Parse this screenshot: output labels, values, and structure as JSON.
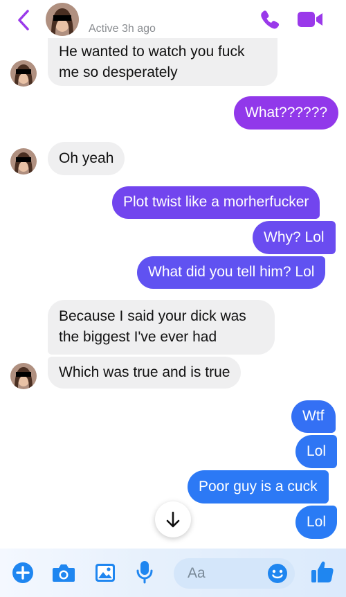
{
  "header": {
    "status": "Active 3h ago",
    "icons": [
      "back-chevron-icon",
      "phone-icon",
      "video-camera-icon"
    ]
  },
  "messages": [
    {
      "side": "in",
      "text": "He wanted to watch you fuck\nme so desperately"
    },
    {
      "side": "out",
      "text": "What??????"
    },
    {
      "side": "in",
      "text": "Oh yeah"
    },
    {
      "side": "out",
      "text": "Plot twist like a morherfucker"
    },
    {
      "side": "out",
      "text": "Why? Lol"
    },
    {
      "side": "out",
      "text": "What did you tell him? Lol"
    },
    {
      "side": "in",
      "text": "Because I said your dick was\nthe biggest I've ever had"
    },
    {
      "side": "in",
      "text": "Which was true and is true"
    },
    {
      "side": "out",
      "text": "Wtf"
    },
    {
      "side": "out",
      "text": "Lol"
    },
    {
      "side": "out",
      "text": "Poor guy is a cuck"
    },
    {
      "side": "out",
      "text": "Lol"
    }
  ],
  "composer": {
    "placeholder": "Aa",
    "icons": [
      "plus-icon",
      "camera-icon",
      "photo-icon",
      "microphone-icon",
      "emoji-icon",
      "thumbs-up-icon"
    ]
  },
  "colors": {
    "accent_purple": "#9a39ea",
    "outgoing_top": "#9138ea",
    "outgoing_bottom": "#2c7bf5",
    "incoming": "#efeff0",
    "composer_icons": "#1f86f0"
  }
}
